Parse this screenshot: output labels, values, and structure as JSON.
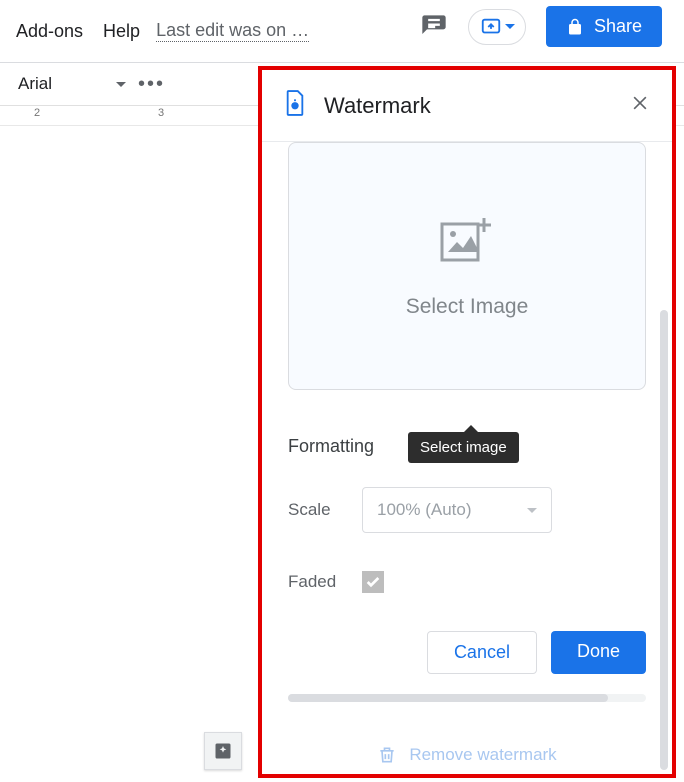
{
  "menubar": {
    "addons": "Add-ons",
    "help": "Help",
    "last_edit": "Last edit was on …"
  },
  "topbar": {
    "share": "Share"
  },
  "toolbar": {
    "font": "Arial"
  },
  "ruler": {
    "n2": "2",
    "n3": "3"
  },
  "panel": {
    "title": "Watermark",
    "select_image": "Select Image",
    "tooltip": "Select image",
    "formatting_heading": "Formatting",
    "scale_label": "Scale",
    "scale_value": "100% (Auto)",
    "faded_label": "Faded",
    "cancel": "Cancel",
    "done": "Done",
    "remove": "Remove watermark"
  }
}
